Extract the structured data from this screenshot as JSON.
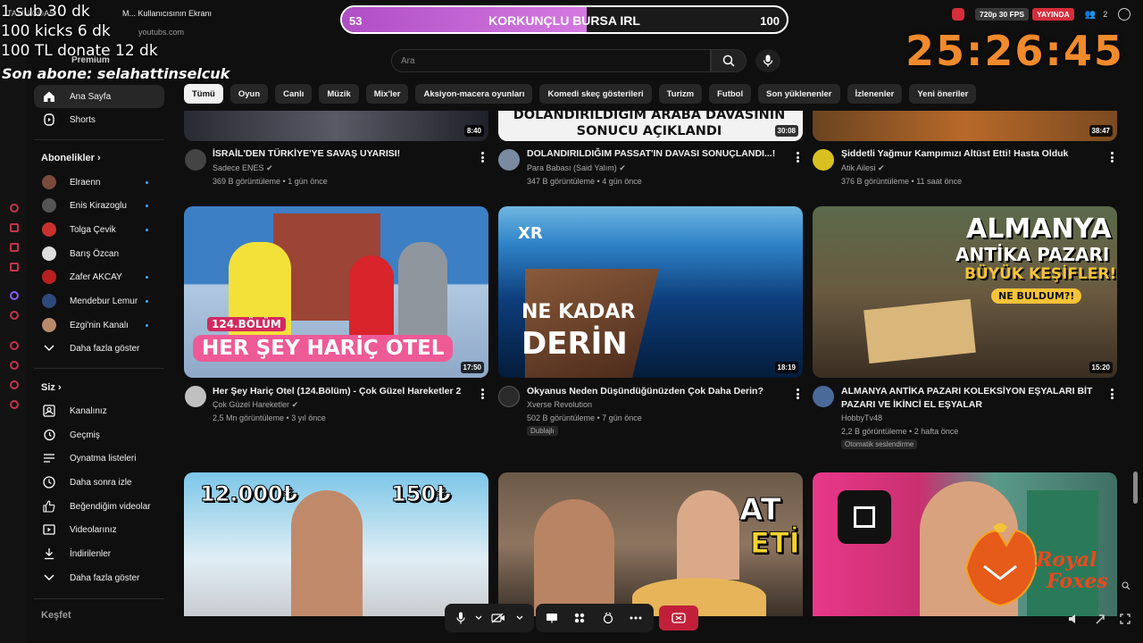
{
  "stream_overlay": {
    "goals": [
      "1 sub 30 dk",
      "100 kicks 6 dk",
      "100 TL donate 12 dk"
    ],
    "last_subscriber": "Son abone: selahattinselcuk",
    "bar": {
      "min": "53",
      "max": "100",
      "title": "KORKUNÇLU BURSA IRL",
      "progress": 0.55
    },
    "timer": "25:26:45",
    "status": {
      "quality": "720p 30 FPS",
      "live": "YAYINDA",
      "viewers": "2"
    },
    "host_window_title": "M... Kullanıcısının Ekranı",
    "host_topline": "TAYIN ODASI",
    "logo_text": "Royal Foxes"
  },
  "youtube": {
    "url_hint": "youtubs.com",
    "logo": "Premium",
    "search": {
      "placeholder": "Ara"
    },
    "sidebar": {
      "main": [
        {
          "label": "Ana Sayfa",
          "icon": "home-icon",
          "active": true
        },
        {
          "label": "Shorts",
          "icon": "shorts-icon"
        }
      ],
      "subscriptions_title": "Abonelikler",
      "subscriptions": [
        {
          "label": "Elraenn",
          "color": "#7a4a3a",
          "live": true
        },
        {
          "label": "Enis Kirazoglu",
          "color": "#555555",
          "live": true
        },
        {
          "label": "Tolga Çevik",
          "color": "#c8322e",
          "live": true
        },
        {
          "label": "Barış Özcan",
          "color": "#dddddd",
          "live": false
        },
        {
          "label": "Zafer AKCAY",
          "color": "#b82020",
          "live": true
        },
        {
          "label": "Mendebur Lemur",
          "color": "#2e4a7a",
          "live": true
        },
        {
          "label": "Ezgi'nin Kanalı",
          "color": "#b88a6a",
          "live": true
        }
      ],
      "show_more": "Daha fazla göster",
      "you_title": "Siz",
      "you_items": [
        {
          "label": "Kanalınız",
          "icon": "channel-icon"
        },
        {
          "label": "Geçmiş",
          "icon": "history-icon"
        },
        {
          "label": "Oynatma listeleri",
          "icon": "playlist-icon"
        },
        {
          "label": "Daha sonra izle",
          "icon": "clock-icon"
        },
        {
          "label": "Beğendiğim videolar",
          "icon": "thumbs-up-icon"
        },
        {
          "label": "Videolarınız",
          "icon": "video-icon"
        },
        {
          "label": "İndirilenler",
          "icon": "download-icon"
        },
        {
          "label": "Daha fazla göster",
          "icon": "chevron-down-icon"
        }
      ],
      "explore_title": "Keşfet"
    },
    "chips": [
      "Tümü",
      "Oyun",
      "Canlı",
      "Müzik",
      "Mix'ler",
      "Aksiyon-macera oyunları",
      "Komedi skeç gösterileri",
      "Turizm",
      "Futbol",
      "Son yüklenenler",
      "İzlenenler",
      "Yeni öneriler"
    ],
    "row1": [
      {
        "duration": "8:40",
        "thumb_text": "",
        "title": "İSRAİL'DEN TÜRKİYE'YE SAVAŞ UYARISI!",
        "channel": "Sadece ENES",
        "meta": "369 B görüntüleme • 1 gün önce"
      },
      {
        "duration": "30:08",
        "thumb_text": "DOLANDIRILDIĞIM ARABA DAVASININ SONUCU AÇIKLANDI",
        "title": "DOLANDIRILDIĞIM PASSAT'IN DAVASI SONUÇLANDI...!",
        "channel": "Para Babası (Said Yalım)",
        "meta": "347 B görüntüleme • 4 gün önce"
      },
      {
        "duration": "38:47",
        "thumb_text": "",
        "title": "Şiddetli Yağmur Kampımızı Altüst Etti! Hasta Olduk",
        "channel": "Atik Ailesi",
        "meta": "376 B görüntüleme • 11 saat önce"
      }
    ],
    "row2": [
      {
        "duration": "17:50",
        "thumb_text_small": "124.BÖLÜM",
        "thumb_text": "HER ŞEY HARİÇ OTEL",
        "title": "Her Şey Hariç Otel (124.Bölüm) - Çok Güzel Hareketler 2",
        "channel": "Çok Güzel Hareketler",
        "meta": "2,5 Mn görüntüleme • 3 yıl önce",
        "badge": ""
      },
      {
        "duration": "18:19",
        "thumb_text_small": "XR",
        "thumb_text": "NE KADAR",
        "thumb_text2": "DERİN",
        "title": "Okyanus Neden Düşündüğünüzden Çok Daha Derin?",
        "channel": "Xverse Revolution",
        "meta": "502 B görüntüleme • 7 gün önce",
        "badge": "Dublajlı"
      },
      {
        "duration": "15:20",
        "thumb_text": "ALMANYA",
        "thumb_text2": "ANTİKA PAZARI",
        "thumb_text3": "BÜYÜK KEŞİFLER!",
        "thumb_text4": "NE BULDUM?!",
        "title": "ALMANYA ANTİKA PAZARI KOLEKSİYON EŞYALARI BİT PAZARI VE İKİNCİ EL EŞYALAR",
        "channel": "HobbyTv48",
        "meta": "2,2 B görüntüleme • 2 hafta önce",
        "badge": "Otomatik seslendirme"
      }
    ],
    "row3": [
      {
        "thumb_text": "12.000₺",
        "thumb_text2": "150₺"
      },
      {
        "thumb_text": "AT",
        "thumb_text2": "ETİ"
      },
      {
        "thumb_text": ""
      }
    ]
  }
}
